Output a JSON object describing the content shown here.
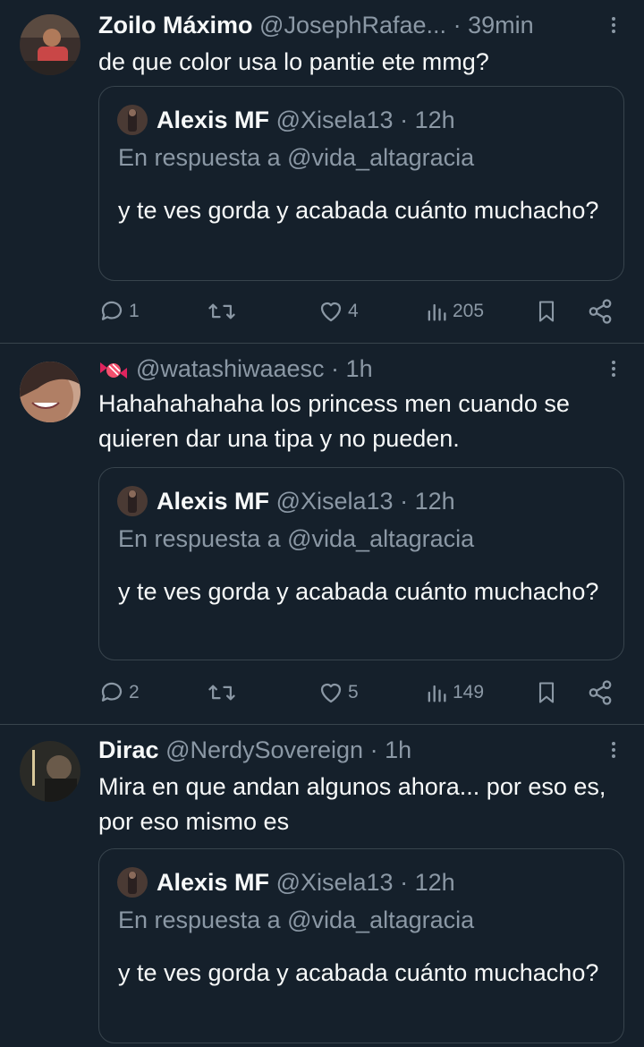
{
  "tweets": [
    {
      "author_name": "Zoilo Máximo",
      "handle": "@JosephRafae...",
      "time": "39min",
      "separator": "·",
      "text": "de que color usa lo pantie ete mmg?",
      "quote": {
        "author_name": "Alexis MF",
        "handle": "@Xisela13",
        "time": "12h",
        "separator": "·",
        "reply_to": "En respuesta a @vida_altagracia",
        "text": "y te ves gorda y acabada cuánto muchacho?"
      },
      "replies": "1",
      "retweets": "",
      "likes": "4",
      "views": "205"
    },
    {
      "author_name": "",
      "handle": "@watashiwaaesc",
      "time": "1h",
      "separator": "·",
      "text": "Hahahahahaha los princess men cuando se quieren dar una tipa y no pueden.",
      "quote": {
        "author_name": "Alexis MF",
        "handle": "@Xisela13",
        "time": "12h",
        "separator": "·",
        "reply_to": "En respuesta a @vida_altagracia",
        "text": "y te ves gorda y acabada cuánto muchacho?"
      },
      "replies": "2",
      "retweets": "",
      "likes": "5",
      "views": "149"
    },
    {
      "author_name": "Dirac",
      "handle": "@NerdySovereign",
      "time": "1h",
      "separator": "·",
      "text": "Mira en que andan algunos ahora... por eso es, por eso mismo es",
      "quote": {
        "author_name": "Alexis MF",
        "handle": "@Xisela13",
        "time": "12h",
        "separator": "·",
        "reply_to": "En respuesta a @vida_altagracia",
        "text": "y te ves gorda y acabada cuánto muchacho?"
      }
    }
  ],
  "colors": {
    "background": "#15202b",
    "text": "#f7f9f9",
    "secondary": "#8b98a5",
    "border": "#38444d"
  },
  "icons": {
    "more": "more-vertical-icon",
    "reply": "reply-icon",
    "retweet": "retweet-icon",
    "like": "heart-icon",
    "views": "views-icon",
    "bookmark": "bookmark-icon",
    "share": "share-icon",
    "name_emoji": "candy-icon"
  }
}
